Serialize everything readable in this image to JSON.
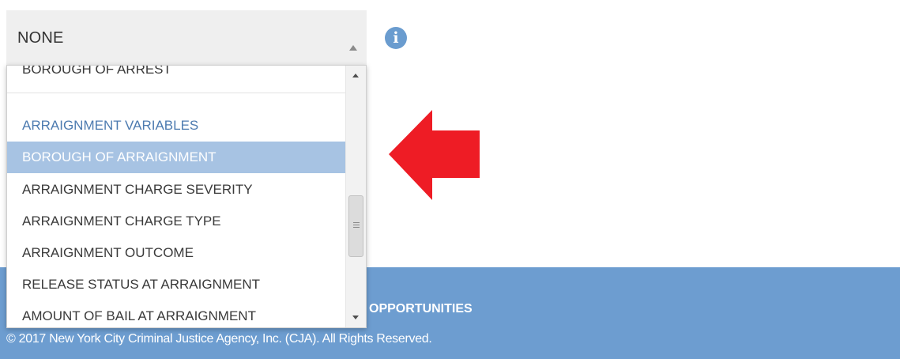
{
  "select": {
    "value": "NONE",
    "caret_icon": "caret-up-icon"
  },
  "info": {
    "glyph": "i",
    "icon": "info-icon",
    "color": "#6a9ccf"
  },
  "annotation": {
    "icon": "red-arrow-left-icon",
    "color": "#ee1c25"
  },
  "dropdown": {
    "items": [
      {
        "label": "BOROUGH OF ARREST",
        "kind": "option"
      },
      {
        "label": "ARRAIGNMENT VARIABLES",
        "kind": "group"
      },
      {
        "label": "BOROUGH OF ARRAIGNMENT",
        "kind": "option",
        "selected": true
      },
      {
        "label": "ARRAIGNMENT CHARGE SEVERITY",
        "kind": "option"
      },
      {
        "label": "ARRAIGNMENT CHARGE TYPE",
        "kind": "option"
      },
      {
        "label": "ARRAIGNMENT OUTCOME",
        "kind": "option"
      },
      {
        "label": "RELEASE STATUS AT ARRAIGNMENT",
        "kind": "option"
      },
      {
        "label": "AMOUNT OF BAIL AT ARRAIGNMENT",
        "kind": "option"
      }
    ],
    "scroll_position_fraction": 0.62
  },
  "footer": {
    "opportunities_label": "OPPORTUNITIES",
    "copyright": "© 2017 New York City Criminal Justice Agency, Inc. (CJA). All Rights Reserved.",
    "background_color": "#6d9dd0"
  },
  "colors": {
    "selected_item_bg": "#a7c3e3",
    "group_label": "#4d7bb0",
    "select_bg": "#efefef"
  }
}
